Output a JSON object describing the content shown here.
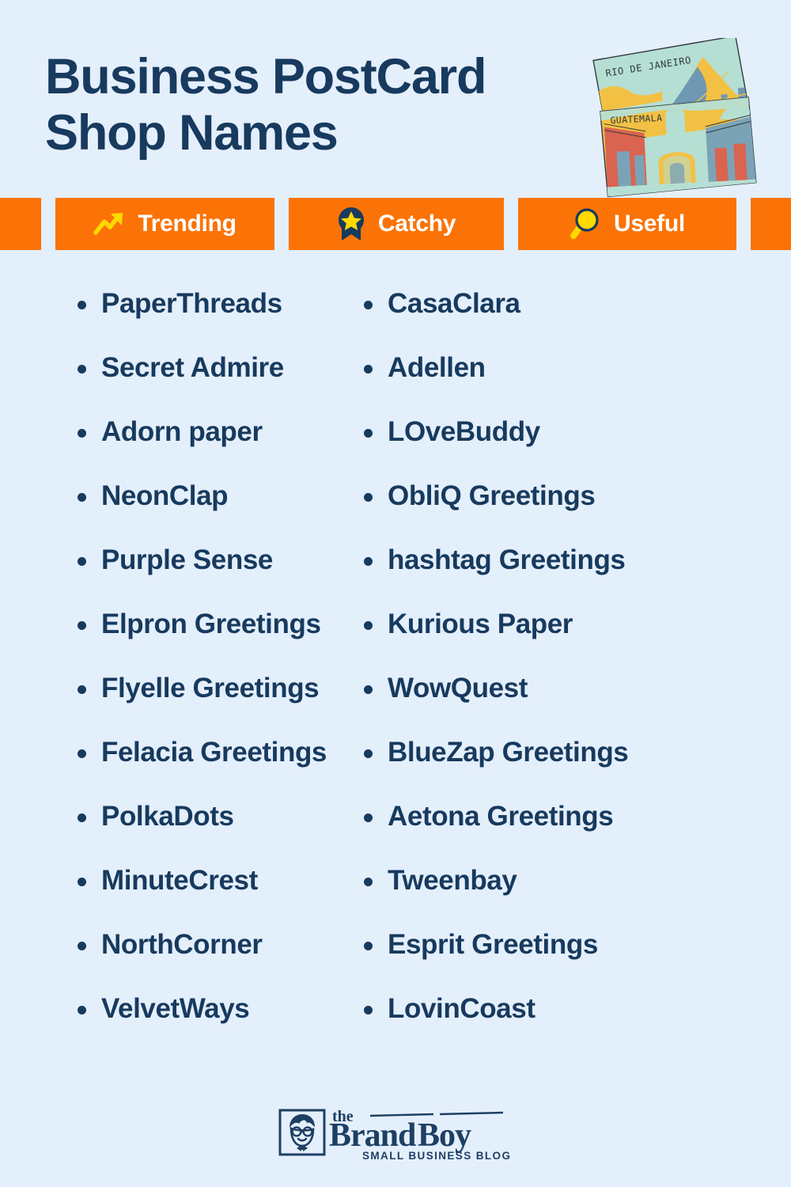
{
  "page": {
    "background_color": "#e4effc",
    "navy": "#173a5e",
    "orange": "#fb7306",
    "yellow": "#ffd900",
    "white": "#ffffff"
  },
  "header": {
    "title_line1": "Business PostCard",
    "title_line2": "Shop Names"
  },
  "illustration": {
    "name": "two-postcards",
    "postcard_back_label": "RIO DE JANEIRO",
    "postcard_front_label": "GUATEMALA",
    "colors": {
      "mint": "#b6dfd4",
      "yellow": "#f2c144",
      "blue_gray": "#6f99b2",
      "red": "#d9644f",
      "ink": "#2f3a3f"
    }
  },
  "badges": [
    {
      "label": "Trending",
      "icon": "trending-up-icon"
    },
    {
      "label": "Catchy",
      "icon": "award-ribbon-star-icon"
    },
    {
      "label": "Useful",
      "icon": "magnifying-glass-icon"
    }
  ],
  "names": {
    "left_column": [
      "PaperThreads",
      "Secret Admire",
      "Adorn paper",
      "NeonClap",
      "Purple Sense",
      "Elpron Greetings",
      "Flyelle Greetings",
      "Felacia Greetings",
      "PolkaDots",
      "MinuteCrest",
      "NorthCorner",
      "VelvetWays"
    ],
    "right_column": [
      "CasaClara",
      "Adellen",
      "LOveBuddy",
      "ObliQ Greetings",
      "hashtag Greetings",
      "Kurious Paper",
      "WowQuest",
      "BlueZap Greetings",
      "Aetona Greetings",
      "Tweenbay",
      "Esprit Greetings",
      "LovinCoast"
    ]
  },
  "footer": {
    "logo_the": "the",
    "logo_brand": "Brand",
    "logo_boy": "Boy",
    "logo_tagline": "SMALL BUSINESS BLOG",
    "logo_icon": "brandboy-face-icon"
  }
}
